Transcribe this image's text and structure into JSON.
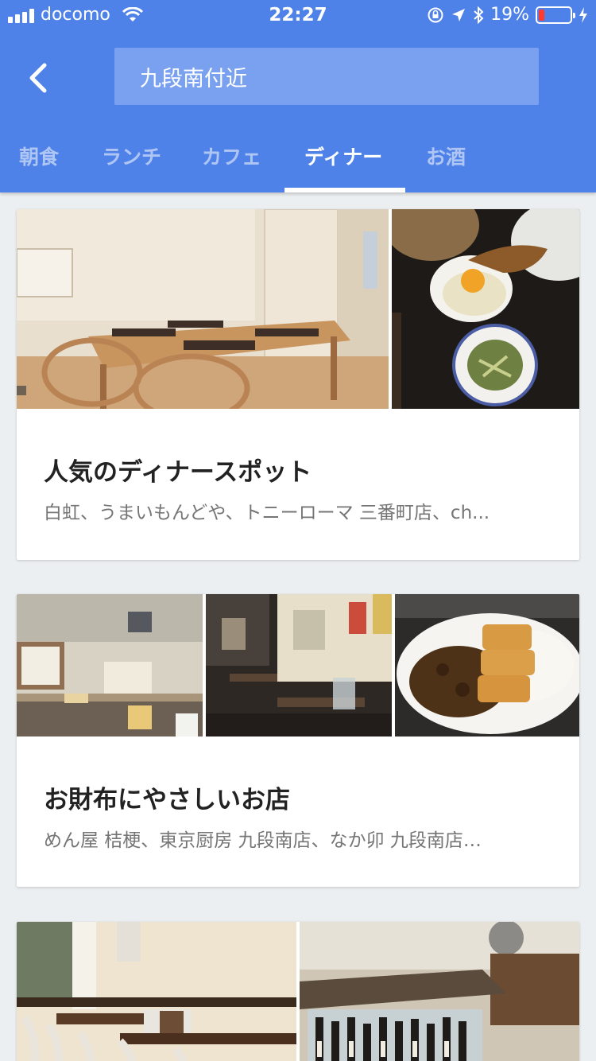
{
  "status_bar": {
    "carrier": "docomo",
    "time": "22:27",
    "battery_percent": "19%",
    "battery_level": 0.19,
    "battery_color": "#ff3b30",
    "icons": [
      "signal-icon",
      "wifi-icon",
      "rotation-lock-icon",
      "location-arrow-icon",
      "bluetooth-icon",
      "charging-icon"
    ]
  },
  "header": {
    "background": "#4f82e8",
    "back_icon": "chevron-left-icon",
    "search_text": "九段南付近"
  },
  "tabs": [
    {
      "label": "朝食",
      "active": false
    },
    {
      "label": "ランチ",
      "active": false
    },
    {
      "label": "カフェ",
      "active": false
    },
    {
      "label": "ディナー",
      "active": true
    },
    {
      "label": "お酒",
      "active": false
    }
  ],
  "cards": [
    {
      "title": "人気のディナースポット",
      "subtitle": "白虹、うまいもんどや、トニーローマ 三番町店、ch...",
      "photos": [
        "dining-room-photo",
        "rice-egg-meal-photo"
      ]
    },
    {
      "title": "お財布にやさしいお店",
      "subtitle": "めん屋 桔梗、東京厨房 九段南店、なか卯 九段南店…",
      "photos": [
        "noodle-counter-photo",
        "restaurant-interior-photo",
        "katsu-curry-photo"
      ]
    },
    {
      "title": "",
      "subtitle": "",
      "photos": [
        "restaurant-seating-photo",
        "sake-bar-photo"
      ]
    }
  ]
}
